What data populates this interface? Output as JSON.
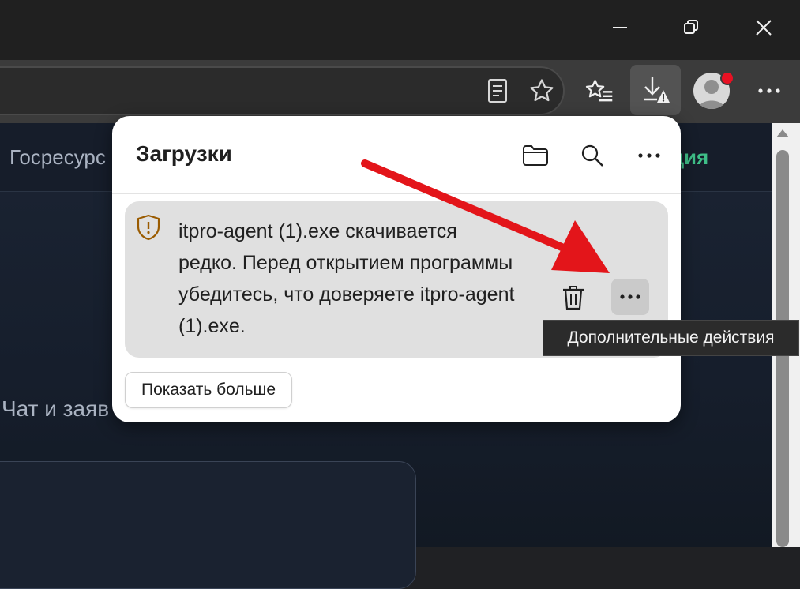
{
  "window": {
    "controls": {
      "minimize_icon": "minimize-icon",
      "restore_icon": "restore-icon",
      "close_icon": "close-icon"
    }
  },
  "toolbar": {
    "reading_view_icon": "reading-view-icon",
    "favorite_icon": "star-icon",
    "favorites_hub_icon": "favorites-icon",
    "downloads_icon": "download-warning-icon",
    "profile_icon": "avatar",
    "settings_icon": "more-icon"
  },
  "page": {
    "nav_left": "Госресурс",
    "nav_right": "ция",
    "chat_label": "Чат и заяв"
  },
  "downloads": {
    "title": "Загрузки",
    "item": {
      "message": "itpro-agent (1).exe скачивается редко. Перед открытием программы убедитесь, что доверяете itpro-agent (1).exe."
    },
    "show_more": "Показать больше",
    "tooltip": "Дополнительные действия"
  },
  "colors": {
    "accent_green": "#3fbf88",
    "warning_shield": "#9a5b00",
    "notification_dot": "#e81123",
    "annotation_arrow": "#e3151a"
  }
}
